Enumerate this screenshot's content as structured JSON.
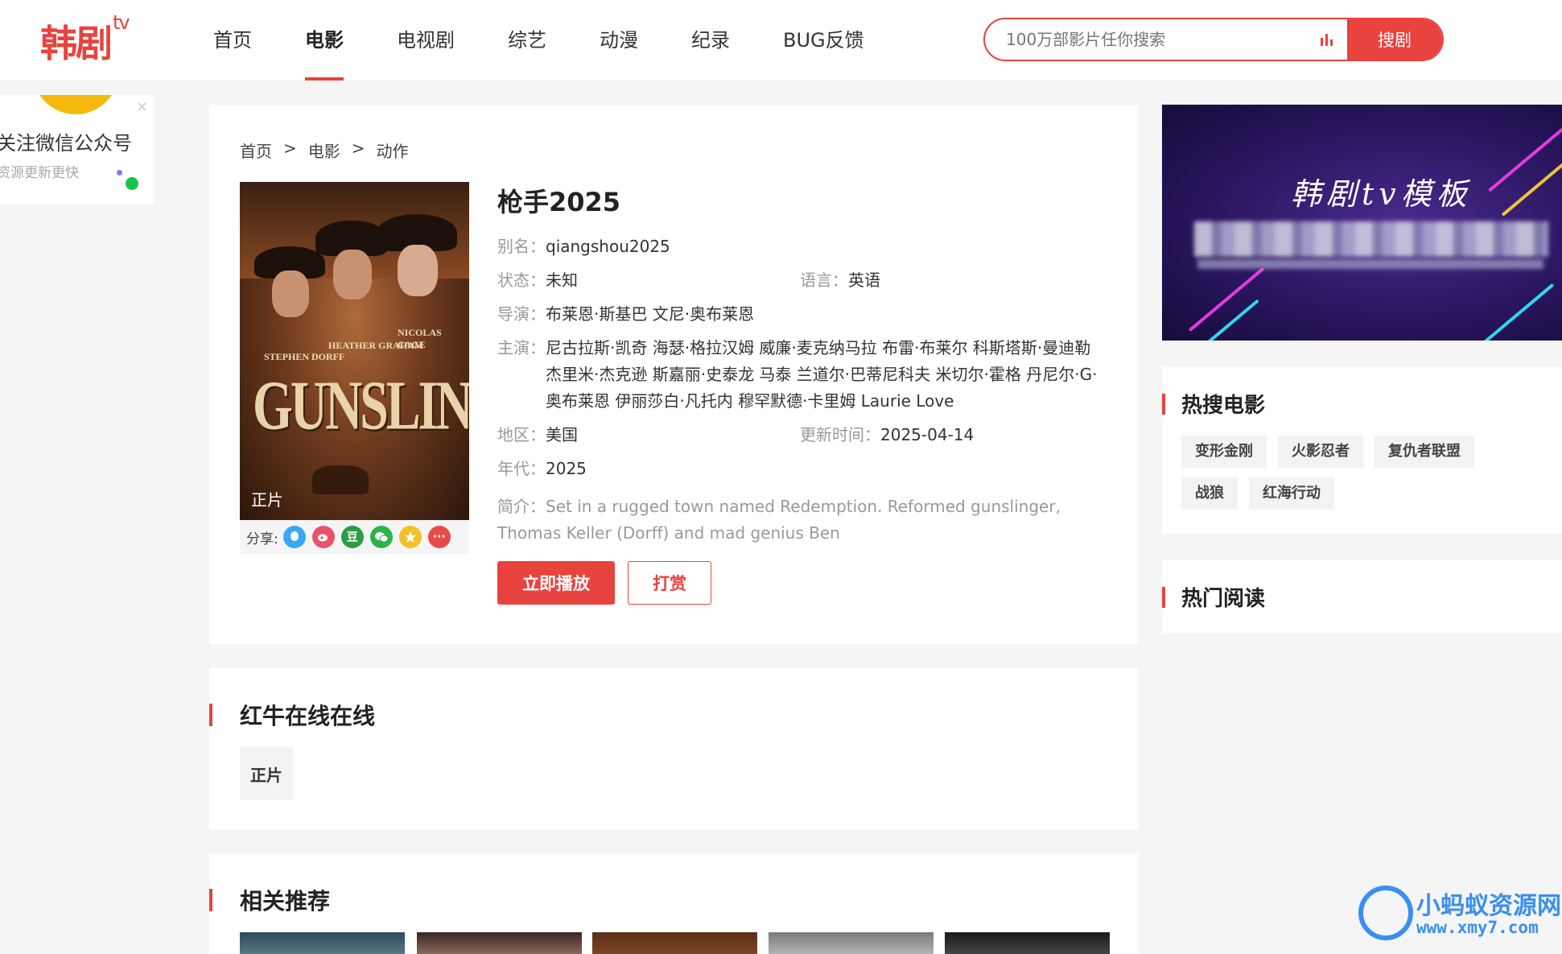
{
  "brand": {
    "logo": "韩剧",
    "logo_sup": "tv"
  },
  "nav": {
    "items": [
      {
        "label": "首页"
      },
      {
        "label": "电影"
      },
      {
        "label": "电视剧"
      },
      {
        "label": "综艺"
      },
      {
        "label": "动漫"
      },
      {
        "label": "纪录"
      },
      {
        "label": "BUG反馈"
      }
    ],
    "active": "电影"
  },
  "search": {
    "placeholder": "100万部影片任你搜索",
    "button_label": "搜剧"
  },
  "float_card": {
    "title": "关注微信公众号",
    "subtitle": "资源更新更快",
    "close": "×"
  },
  "breadcrumb": [
    "首页",
    ">",
    "电影",
    ">",
    "动作"
  ],
  "movie": {
    "title": "枪手2025",
    "poster_badge": "正片",
    "poster_title": "GUNSLINGERS",
    "poster_names": [
      "STEPHEN DORFF",
      "HEATHER GRAHAM",
      "NICOLAS CAGE"
    ],
    "alias_label": "别名：",
    "alias": "qiangshou2025",
    "status_label": "状态：",
    "status": "未知",
    "language_label": "语言：",
    "language": "英语",
    "director_label": "导演：",
    "director": "布莱恩·斯基巴 文尼·奥布莱恩",
    "cast_label": "主演：",
    "cast": "尼古拉斯·凯奇 海瑟·格拉汉姆 威廉·麦克纳马拉 布雷·布莱尔 科斯塔斯·曼迪勒 杰里米·杰克逊 斯嘉丽·史泰龙 马泰 兰道尔·巴蒂尼科夫 米切尔·霍格 丹尼尔·G·奥布莱恩 伊丽莎白·凡托内 穆罕默德·卡里姆 Laurie Love",
    "region_label": "地区：",
    "region": "美国",
    "updated_label": "更新时间：",
    "updated": "2025-04-14",
    "year_label": "年代：",
    "year": "2025",
    "summary_label": "简介：",
    "summary": "Set in a rugged town named Redemption. Reformed gunslinger, Thomas Keller (Dorff) and mad genius Ben"
  },
  "share": {
    "label": "分享:",
    "icons": [
      {
        "name": "qq-icon",
        "glyph": "",
        "color": "#3aa6f4"
      },
      {
        "name": "weibo-icon",
        "glyph": "",
        "color": "#e8526a"
      },
      {
        "name": "douban-icon",
        "glyph": "豆",
        "color": "#2e9b47"
      },
      {
        "name": "wechat-icon",
        "glyph": "",
        "color": "#2bb44a"
      },
      {
        "name": "favorite-icon",
        "glyph": "",
        "color": "#f5c02a"
      },
      {
        "name": "more-icon",
        "glyph": "···",
        "color": "#e84a4a"
      }
    ]
  },
  "actions": {
    "play": "立即播放",
    "reward": "打赏"
  },
  "online": {
    "title": "红牛在线在线",
    "episodes": [
      "正片"
    ]
  },
  "related": {
    "title": "相关推荐"
  },
  "banner": {
    "title": "韩剧tv模板"
  },
  "hot": {
    "title": "热搜电影",
    "tags": [
      "变形金刚",
      "火影忍者",
      "复仇者联盟",
      "战狼",
      "红海行动"
    ]
  },
  "reading": {
    "title": "热门阅读"
  },
  "watermark": {
    "line1": "小蚂蚁资源网",
    "line2": "www.xmy7.com"
  },
  "colors": {
    "accent": "#e8433e",
    "background": "#f5f5f5"
  }
}
